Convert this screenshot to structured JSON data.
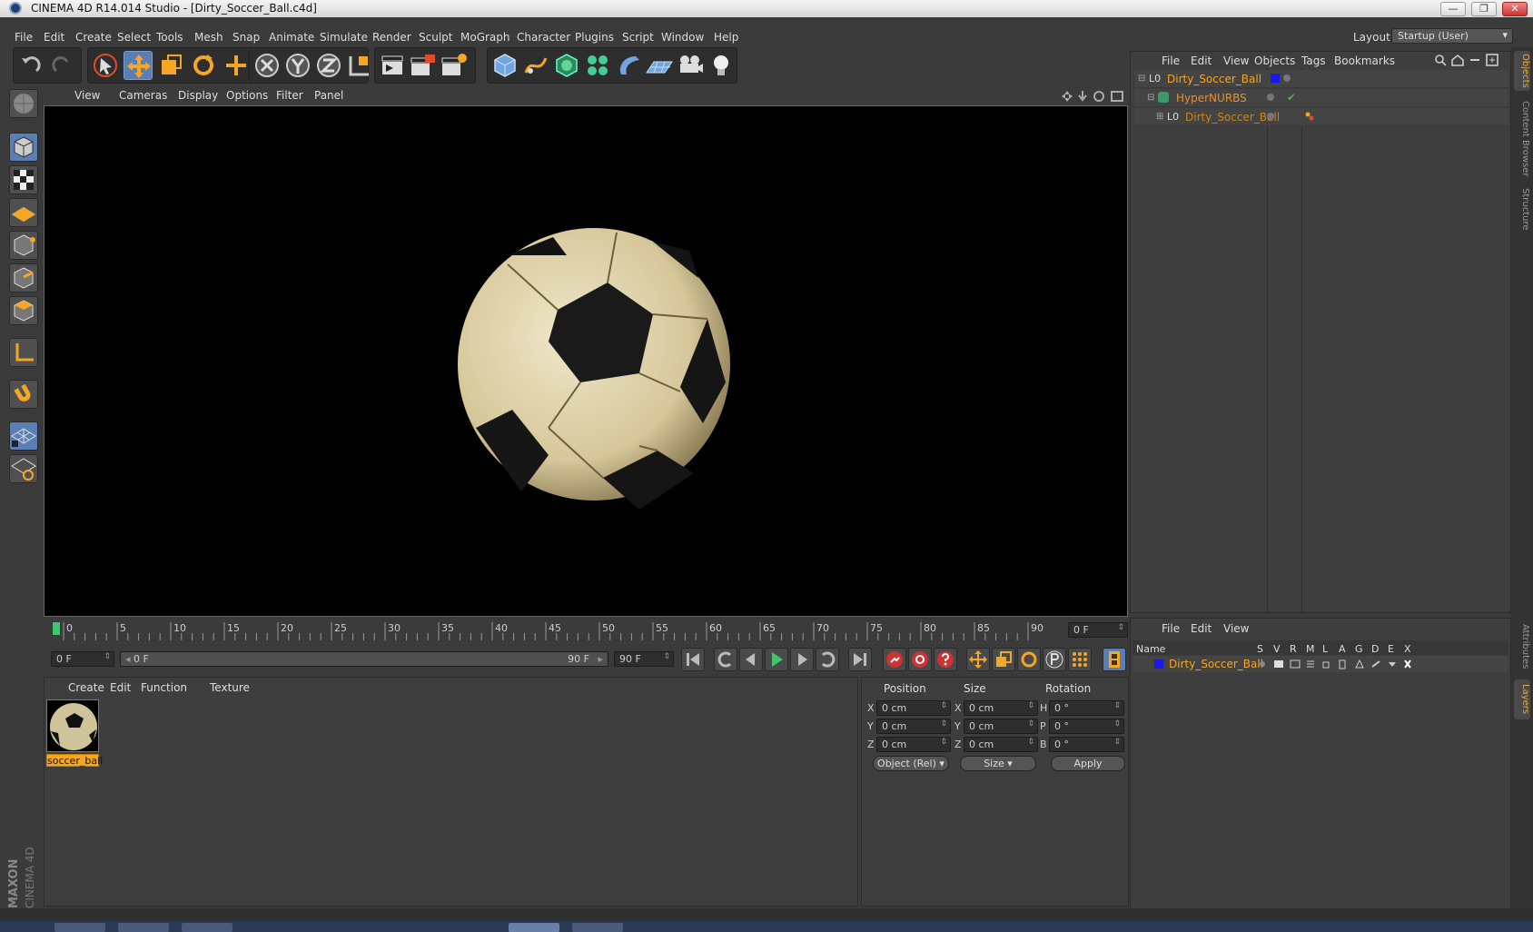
{
  "window": {
    "title": "CINEMA 4D R14.014 Studio - [Dirty_Soccer_Ball.c4d]",
    "btn_min": "—",
    "btn_max": "❐",
    "btn_close": "✕"
  },
  "menubar": {
    "items": [
      "File",
      "Edit",
      "Create",
      "Select",
      "Tools",
      "Mesh",
      "Snap",
      "Animate",
      "Simulate",
      "Render",
      "Sculpt",
      "MoGraph",
      "Character",
      "Plugins",
      "Script",
      "Window",
      "Help"
    ],
    "layout_label": "Layout:",
    "layout_value": "Startup (User)",
    "arrow": "▾"
  },
  "viewport": {
    "menu": [
      "View",
      "Cameras",
      "Display",
      "Options",
      "Filter",
      "Panel"
    ]
  },
  "timeline": {
    "ticks": [
      "0",
      "5",
      "10",
      "15",
      "20",
      "25",
      "30",
      "35",
      "40",
      "45",
      "50",
      "55",
      "60",
      "65",
      "70",
      "75",
      "80",
      "85",
      "90"
    ],
    "current_frame": "0 F",
    "range_start": "0 F",
    "range_slider_left": "0 F",
    "range_slider_right": "90 F",
    "range_end": "90 F",
    "arrow_left": "◂",
    "arrow_right": "▸",
    "spinner": "⇕"
  },
  "material_manager": {
    "menu": [
      "Create",
      "Edit",
      "Function",
      "Texture"
    ],
    "materials": [
      {
        "name": "soccer_ball"
      }
    ]
  },
  "coordinates": {
    "headers": {
      "position": "Position",
      "size": "Size",
      "rotation": "Rotation"
    },
    "rows": [
      {
        "axis_p": "X",
        "pos": "0 cm",
        "axis_s": "X",
        "size": "0 cm",
        "axis_r": "H",
        "rot": "0 °"
      },
      {
        "axis_p": "Y",
        "pos": "0 cm",
        "axis_s": "Y",
        "size": "0 cm",
        "axis_r": "P",
        "rot": "0 °"
      },
      {
        "axis_p": "Z",
        "pos": "0 cm",
        "axis_s": "Z",
        "size": "0 cm",
        "axis_r": "B",
        "rot": "0 °"
      }
    ],
    "mode": "Object (Rel)",
    "size_mode": "Size",
    "apply": "Apply",
    "arrow": "▾"
  },
  "object_manager": {
    "menu": [
      "File",
      "Edit",
      "View",
      "Objects",
      "Tags",
      "Bookmarks"
    ],
    "objects": [
      {
        "name": "Dirty_Soccer_Ball",
        "color": "#f5a623"
      },
      {
        "name": "HyperNURBS",
        "color": "#e8902a"
      },
      {
        "name": "Dirty_Soccer_Ball",
        "color": "#c8861f"
      }
    ],
    "check": "✔"
  },
  "layer_manager": {
    "menu": [
      "File",
      "Edit",
      "View"
    ],
    "columns": [
      "Name",
      "S",
      "V",
      "R",
      "M",
      "L",
      "A",
      "G",
      "D",
      "E",
      "X"
    ],
    "layers": [
      {
        "name": "Dirty_Soccer_Ball",
        "color": "#1a1ae6"
      }
    ]
  },
  "right_tabs": [
    "Objects",
    "Content Browser",
    "Structure",
    "Attributes",
    "Layers"
  ],
  "brand": {
    "line1": "MAXON",
    "line2": "CINEMA 4D"
  },
  "colors": {
    "accent": "#f5a623",
    "selection": "#5a7fb5",
    "play": "#3ec86e"
  }
}
